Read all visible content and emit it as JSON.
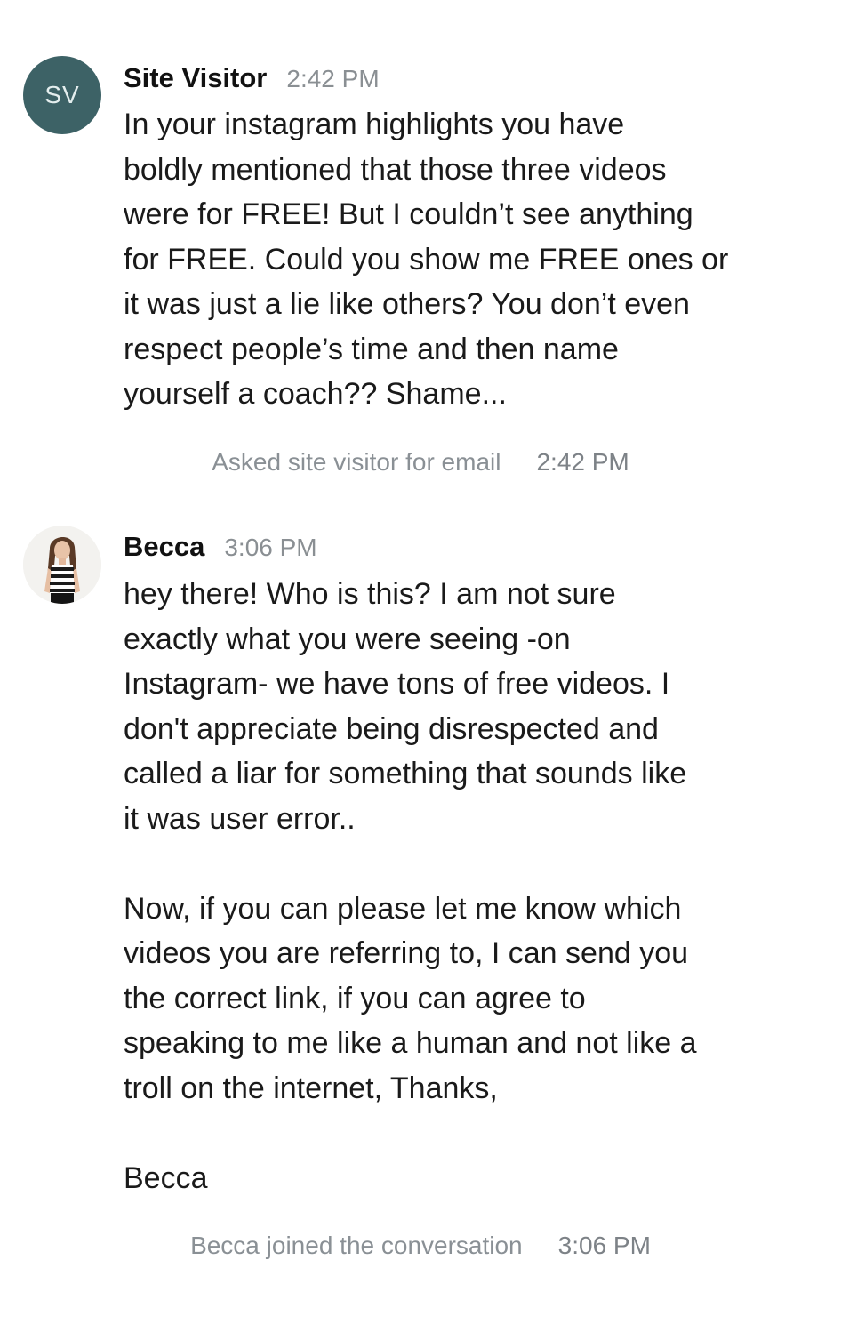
{
  "messages": [
    {
      "avatar_initials": "SV",
      "sender": "Site Visitor",
      "time": "2:42 PM",
      "lines": [
        "In your instagram highlights you have",
        "boldly mentioned that those three videos",
        "were for FREE! But I couldn’t see anything",
        "for FREE. Could you show me FREE ones or",
        "it was just a lie like others? You don’t even",
        "respect people’s time and then name",
        "yourself a coach?? Shame..."
      ]
    },
    {
      "avatar_icon": "profile-photo-icon",
      "sender": "Becca",
      "time": "3:06 PM",
      "lines": [
        "hey there! Who is this? I am not sure",
        "exactly what you were seeing -on",
        "Instagram- we have tons of free videos. I",
        "don't appreciate being disrespected and",
        "called a liar for something that sounds like",
        "it was user error..",
        "Now, if you can please let me know which",
        "videos you are referring to, I can send you",
        "the correct link, if you can agree to",
        "speaking to me like a human and not like a",
        "troll on the internet, Thanks,",
        "Becca"
      ]
    }
  ],
  "system_notes": [
    {
      "text": "Asked site visitor for email",
      "time": "2:42 PM"
    },
    {
      "text": "Becca joined the conversation",
      "time": "3:06 PM"
    }
  ],
  "colors": {
    "avatar_bg": "#3d6266",
    "muted_text": "#8a9095",
    "body_text": "#1a1a1a"
  }
}
